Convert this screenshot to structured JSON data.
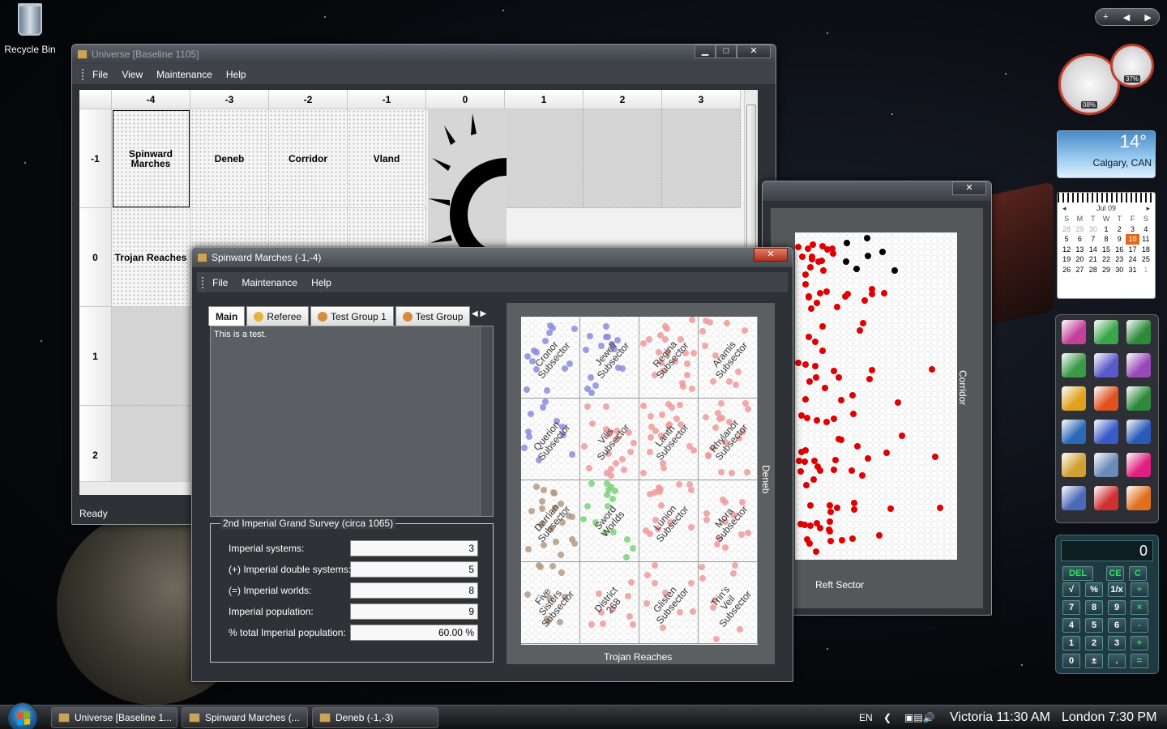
{
  "desktop": {
    "recycle_bin_label": "Recycle Bin"
  },
  "universe_window": {
    "title": "Universe [Baseline 1105]",
    "menu": [
      "File",
      "View",
      "Maintenance",
      "Help"
    ],
    "columns": [
      "-4",
      "-3",
      "-2",
      "-1",
      "0",
      "1",
      "2",
      "3"
    ],
    "rows": [
      "-1",
      "0",
      "1",
      "2"
    ],
    "cells_row_minus1": [
      "Spinward Marches",
      "Deneb",
      "Corridor",
      "Vland"
    ],
    "cells_row_0": [
      "Trojan Reaches"
    ],
    "status": "Ready"
  },
  "deneb_window": {
    "title": "Deneb (-1,-3)",
    "bottom_label": "Reft Sector",
    "right_label": "Corridor"
  },
  "spinward_window": {
    "title": "Spinward Marches (-1,-4)",
    "menu": [
      "File",
      "Maintenance",
      "Help"
    ],
    "tabs": [
      "Main",
      "Referee",
      "Test Group 1",
      "Test Group"
    ],
    "notes_text": "This is a test.",
    "survey": {
      "legend": "2nd Imperial Grand Survey (circa 1065)",
      "rows": [
        {
          "label": "Imperial systems:",
          "value": "3"
        },
        {
          "label": "(+) Imperial double systems:",
          "value": "5"
        },
        {
          "label": "(=) Imperial worlds:",
          "value": "8"
        },
        {
          "label": "Imperial population:",
          "value": "9"
        },
        {
          "label": "% total Imperial population:",
          "value": "60.00 %"
        }
      ]
    },
    "subsectors": [
      "Cronor\nSubsector",
      "Jewell\nSubsector",
      "Regina\nSubsector",
      "Aramis\nSubsector",
      "Querion\nSubsector",
      "Vilis\nSubsector",
      "Lanth\nSubsector",
      "Rhylanor\nSubsector",
      "Darrian\nSubsector",
      "Sword\nWorlds",
      "Lunion\nSubsector",
      "Mora\nSubsector",
      "Five\nSisters\nSubsector",
      "District\n268",
      "Glisten\nSubsector",
      "Trin's\nVeil\nSubsector"
    ],
    "bottom_label": "Trojan Reaches",
    "right_label": "Deneb"
  },
  "gadgets": {
    "cpu_meter": "08%",
    "mem_meter": "37%",
    "weather_temp": "14°",
    "weather_location": "Calgary, CAN",
    "calendar_month": "Jul 09",
    "calendar_dow": [
      "S",
      "M",
      "T",
      "W",
      "T",
      "F",
      "S"
    ],
    "calendar_days": [
      "28",
      "29",
      "30",
      "1",
      "2",
      "3",
      "4",
      "5",
      "6",
      "7",
      "8",
      "9",
      "10",
      "11",
      "12",
      "13",
      "14",
      "15",
      "16",
      "17",
      "18",
      "19",
      "20",
      "21",
      "22",
      "23",
      "24",
      "25",
      "26",
      "27",
      "28",
      "29",
      "30",
      "31",
      "1"
    ],
    "calendar_today": "10",
    "calculator_display": "0",
    "calc_keys": [
      "DEL",
      "CE",
      "C",
      "√",
      "%",
      "1/x",
      "÷",
      "7",
      "8",
      "9",
      "×",
      "4",
      "5",
      "6",
      "-",
      "1",
      "2",
      "3",
      "+",
      "0",
      "±",
      ".",
      "="
    ]
  },
  "taskbar": {
    "buttons": [
      "Universe [Baseline 1...",
      "Spinward Marches (...",
      "Deneb (-1,-3)"
    ],
    "language": "EN",
    "clock_1": "Victoria  11:30 AM",
    "clock_2": "London  7:30 PM"
  }
}
